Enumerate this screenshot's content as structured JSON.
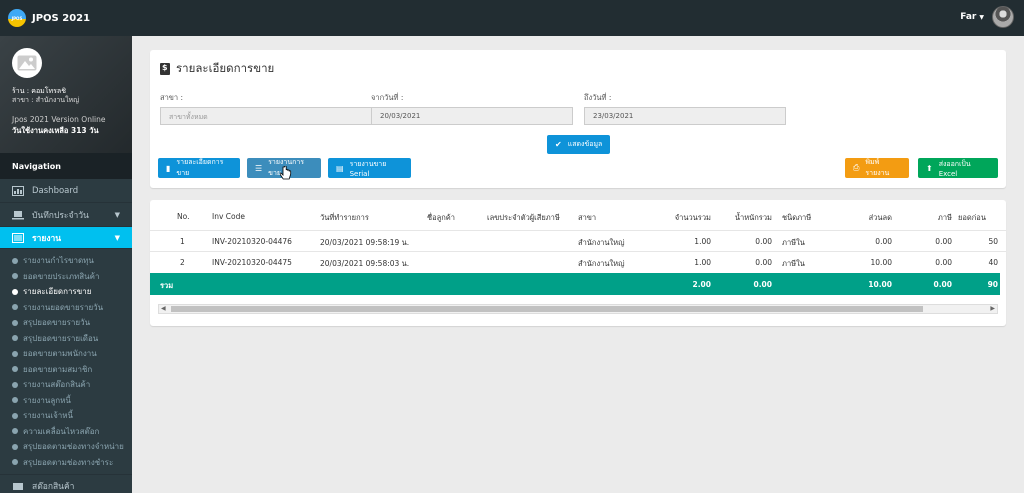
{
  "app": {
    "logo_text": "JPOS",
    "title": "JPOS 2021",
    "user_name": "Far"
  },
  "sidebar": {
    "shop": "ร้าน : คอมโทรลชิ",
    "branch": "สาขา : สำนักงานใหญ่",
    "version": "Jpos 2021 Version Online",
    "days_left": "วันใช้งานคงเหลือ 313 วัน",
    "nav_header": "Navigation",
    "menu": [
      {
        "label": "Dashboard",
        "icon": "dashboard-icon"
      },
      {
        "label": "บันทึกประจำวัน",
        "icon": "laptop-icon"
      },
      {
        "label": "รายงาน",
        "icon": "report-icon"
      }
    ],
    "sub_items": [
      "รายงานกำไรขาดทุน",
      "ยอดขายประเภทสินค้า",
      "รายละเอียดการขาย",
      "รายงานยอดขายรายวัน",
      "สรุปยอดขายรายวัน",
      "สรุปยอดขายรายเดือน",
      "ยอดขายตามพนักงาน",
      "ยอดขายตามสมาชิก",
      "รายงานสต๊อกสินค้า",
      "รายงานลูกหนี้",
      "รายงานเจ้าหนี้",
      "ความเคลื่อนไหวสต๊อก",
      "สรุปยอดตามช่องทางจำหน่าย",
      "สรุปยอดตามช่องทางชำระ"
    ],
    "bottom_item": "สต๊อกสินค้า"
  },
  "filter": {
    "page_title": "รายละเอียดการขาย",
    "branch_label": "สาขา :",
    "branch_placeholder": "สาขาทั้งหมด",
    "from_label": "จากวันที่ :",
    "from_value": "20/03/2021",
    "to_label": "ถึงวันที่ :",
    "to_value": "23/03/2021",
    "show_button": "แสดงข้อมูล",
    "tab_detail": "รายละเอียดการขาย",
    "tab_items": "รายงานการขาย",
    "tab_serial": "รายงานขาย Serial",
    "print_button": "พิมพ์รายงาน",
    "excel_button": "ส่งออกเป็น Excel"
  },
  "table": {
    "headers": [
      "No.",
      "Inv Code",
      "วันที่ทำรายการ",
      "ชื่อลูกค้า",
      "เลขประจำตัวผู้เสียภาษี",
      "สาขา",
      "จำนวนรวม",
      "น้ำหนักรวม",
      "ชนิดภาษี",
      "ส่วนลด",
      "ภาษี",
      "ยอดก่อน"
    ],
    "rows": [
      {
        "no": "1",
        "inv": "INV-20210320-04476",
        "date": "20/03/2021 09:58:19 น.",
        "customer": "",
        "tax_id": "",
        "branch": "สำนักงานใหญ่",
        "qty": "1.00",
        "weight": "0.00",
        "tax_type": "ภาษีใน",
        "discount": "0.00",
        "tax": "0.00",
        "subtotal": "50"
      },
      {
        "no": "2",
        "inv": "INV-20210320-04475",
        "date": "20/03/2021 09:58:03 น.",
        "customer": "",
        "tax_id": "",
        "branch": "สำนักงานใหญ่",
        "qty": "1.00",
        "weight": "0.00",
        "tax_type": "ภาษีใน",
        "discount": "10.00",
        "tax": "0.00",
        "subtotal": "40"
      }
    ],
    "total": {
      "label": "รวม",
      "qty": "2.00",
      "weight": "0.00",
      "discount": "10.00",
      "tax": "0.00",
      "subtotal": "90"
    }
  },
  "colors": {
    "topbar": "#222d32",
    "sidebar": "#2c3b41",
    "active": "#00c0ef",
    "total_row": "#00a088",
    "btn_blue": "#3c8dbc",
    "btn_orange": "#f39c12",
    "btn_green": "#00a65a"
  }
}
